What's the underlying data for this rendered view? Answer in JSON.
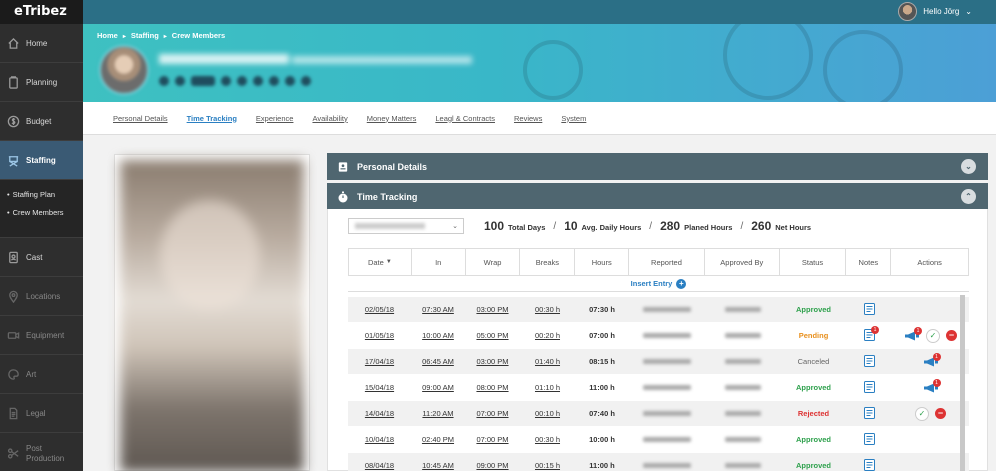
{
  "app": {
    "logo": "eTribez"
  },
  "user": {
    "greeting": "Hello Jörg"
  },
  "sidebar": {
    "items": [
      {
        "label": "Home",
        "icon": "home-icon"
      },
      {
        "label": "Planning",
        "icon": "clipboard-icon"
      },
      {
        "label": "Budget",
        "icon": "dollar-icon"
      },
      {
        "label": "Staffing",
        "icon": "director-chair-icon"
      },
      {
        "label": "Cast",
        "icon": "id-badge-icon"
      },
      {
        "label": "Locations",
        "icon": "map-pin-icon"
      },
      {
        "label": "Equipment",
        "icon": "camera-icon"
      },
      {
        "label": "Art",
        "icon": "palette-icon"
      },
      {
        "label": "Legal",
        "icon": "document-icon"
      },
      {
        "label": "Post Production",
        "icon": "scissors-icon"
      }
    ],
    "subitems": [
      "Staffing Plan",
      "Crew Members"
    ]
  },
  "breadcrumb": [
    "Home",
    "Staffing",
    "Crew Members"
  ],
  "tabs": [
    "Personal Details",
    "Time Tracking",
    "Experience",
    "Availability",
    "Money Matters",
    "Leagl & Contracts",
    "Reviews",
    "System"
  ],
  "panels": {
    "personal": "Personal Details",
    "time": "Time Tracking"
  },
  "summary": {
    "total_days": "100",
    "total_days_label": "Total Days",
    "avg_hours": "10",
    "avg_hours_label": "Avg. Daily Hours",
    "planned": "280",
    "planned_label": "Planed Hours",
    "net": "260",
    "net_label": "Net Hours"
  },
  "table": {
    "headers": [
      "Date",
      "In",
      "Wrap",
      "Breaks",
      "Hours",
      "Reported",
      "Approved By",
      "Status",
      "Notes",
      "Actions"
    ],
    "sort_indicator": "▼",
    "insert_label": "Insert Entry",
    "rows": [
      {
        "date": "02/05/18",
        "in": "07:30 AM",
        "wrap": "03:00 PM",
        "breaks": "00:30 h",
        "hours": "07:30 h",
        "status": "Approved",
        "cls": "st-approved",
        "mega": false,
        "ok": false,
        "no": false
      },
      {
        "date": "01/05/18",
        "in": "10:00 AM",
        "wrap": "05:00 PM",
        "breaks": "00:20 h",
        "hours": "07:00 h",
        "status": "Pending",
        "cls": "st-pending",
        "note_badge": "1",
        "mega": true,
        "mega_badge": "1",
        "ok": true,
        "no": true
      },
      {
        "date": "17/04/18",
        "in": "06:45 AM",
        "wrap": "03:00 PM",
        "breaks": "01:40 h",
        "hours": "08:15 h",
        "status": "Canceled",
        "cls": "st-canceled",
        "mega": true,
        "mega_badge": "1",
        "ok": false,
        "no": false
      },
      {
        "date": "15/04/18",
        "in": "09:00 AM",
        "wrap": "08:00 PM",
        "breaks": "01:10 h",
        "hours": "11:00 h",
        "status": "Approved",
        "cls": "st-approved",
        "mega": true,
        "mega_badge": "1",
        "ok": false,
        "no": false
      },
      {
        "date": "14/04/18",
        "in": "11:20 AM",
        "wrap": "07:00 PM",
        "breaks": "00:10 h",
        "hours": "07:40 h",
        "status": "Rejected",
        "cls": "st-rejected",
        "mega": false,
        "ok": true,
        "no": true
      },
      {
        "date": "10/04/18",
        "in": "02:40 PM",
        "wrap": "07:00 PM",
        "breaks": "00:30 h",
        "hours": "10:00 h",
        "status": "Approved",
        "cls": "st-approved",
        "mega": false,
        "ok": false,
        "no": false
      },
      {
        "date": "08/04/18",
        "in": "10:45 AM",
        "wrap": "09:00 PM",
        "breaks": "00:15 h",
        "hours": "11:00 h",
        "status": "Approved",
        "cls": "st-approved",
        "mega": false,
        "ok": false,
        "no": false
      }
    ]
  },
  "colors": {
    "sidebar": "#2e2e2e",
    "active": "#3a5a74",
    "panel": "#4f6670",
    "accent": "#2a7fc2",
    "approved": "#2fa14d",
    "pending": "#e8901e",
    "rejected": "#dd3333"
  }
}
